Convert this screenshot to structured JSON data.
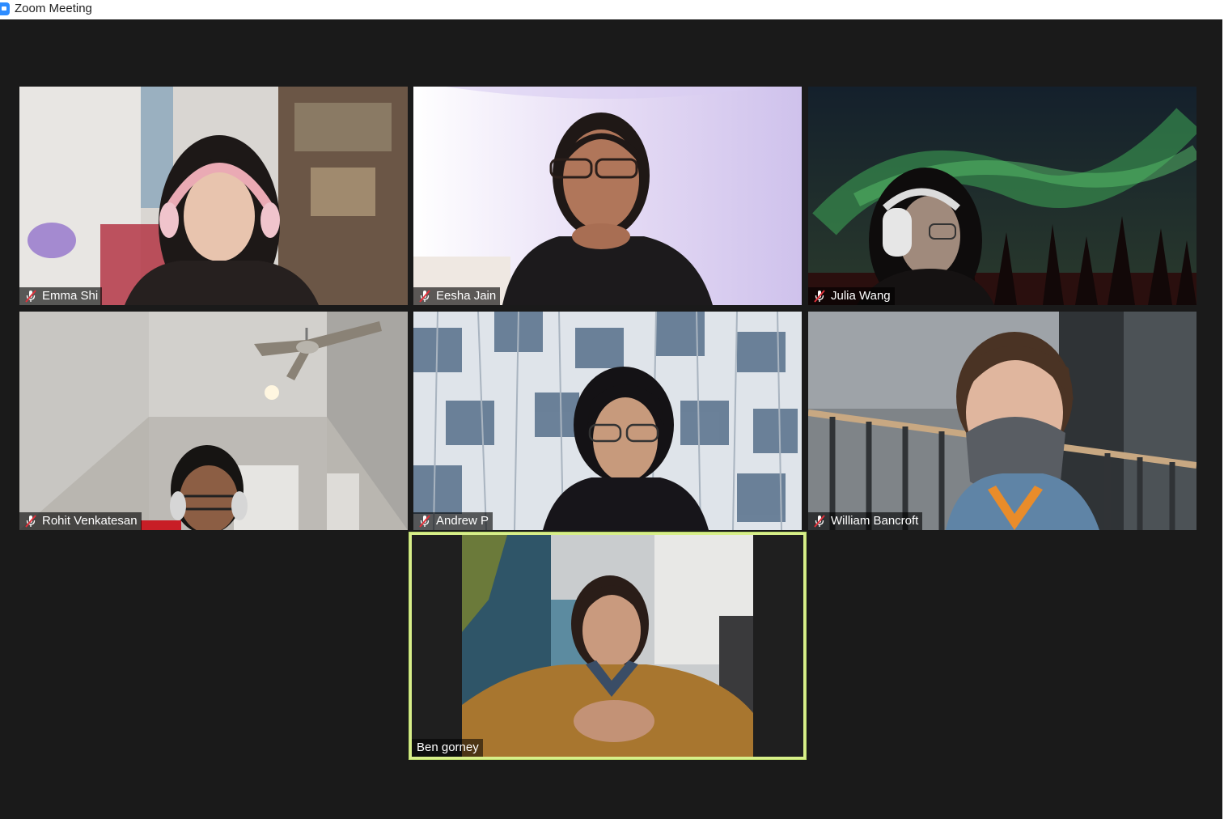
{
  "window": {
    "title": "Zoom Meeting",
    "icon": "zoom-camera-icon"
  },
  "colors": {
    "stage_bg": "#1a1a1a",
    "active_speaker_border": "#d8ef8a",
    "muted_icon": "#e0303a"
  },
  "participants": [
    {
      "name": "Emma Shi",
      "muted": true
    },
    {
      "name": "Eesha Jain",
      "muted": true
    },
    {
      "name": "Julia Wang",
      "muted": true
    },
    {
      "name": "Rohit Venkatesan",
      "muted": true
    },
    {
      "name": "Andrew P",
      "muted": true
    },
    {
      "name": "William Bancroft",
      "muted": true
    },
    {
      "name": "Ben gorney",
      "muted": false,
      "active_speaker": true
    }
  ]
}
